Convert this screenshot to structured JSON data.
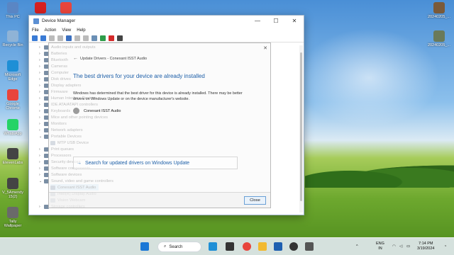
{
  "desktop": {
    "icons_left": [
      {
        "label": "This PC",
        "color": "#5a86c4"
      },
      {
        "label": "Recycle Bin",
        "color": "#8fb3d6"
      },
      {
        "label": "Microsoft Edge",
        "color": "#1e8fd6"
      },
      {
        "label": "Google Chrome",
        "color": "#e8453c"
      },
      {
        "label": "WhatsApp",
        "color": "#25d366"
      },
      {
        "label": "ElevenLabs",
        "color": "#444444"
      },
      {
        "label": "V_5Amendy 15(2)",
        "color": "#444444"
      },
      {
        "label": "Tally Wallpaper",
        "color": "#6a6a6a"
      }
    ],
    "icons_top": [
      {
        "label": "",
        "color": "#d62020"
      },
      {
        "label": "",
        "color": "#e8453c"
      }
    ],
    "icons_right": [
      {
        "label": "20240205_...",
        "color": "#7a5a3a"
      },
      {
        "label": "20240205_...",
        "color": "#6a7a5a"
      }
    ]
  },
  "window": {
    "title": "Device Manager",
    "menu": [
      "File",
      "Action",
      "View",
      "Help"
    ],
    "tree": [
      {
        "label": "Audio inputs and outputs",
        "expanded": false,
        "child": false
      },
      {
        "label": "Batteries",
        "child": false
      },
      {
        "label": "Bluetooth",
        "child": false
      },
      {
        "label": "Cameras",
        "child": false
      },
      {
        "label": "Computer",
        "child": false
      },
      {
        "label": "Disk drives",
        "child": false
      },
      {
        "label": "Display adapters",
        "child": false
      },
      {
        "label": "Firmware",
        "child": false
      },
      {
        "label": "Human Interface Devices",
        "child": false
      },
      {
        "label": "IDE ATA/ATAPI controllers",
        "child": false
      },
      {
        "label": "Keyboards",
        "child": false
      },
      {
        "label": "Mice and other pointing devices",
        "child": false
      },
      {
        "label": "Monitors",
        "child": false
      },
      {
        "label": "Network adapters",
        "child": false
      },
      {
        "label": "Portable Devices",
        "child": false,
        "expanded": true
      },
      {
        "label": "MTP USB Device",
        "child": true
      },
      {
        "label": "Print queues",
        "child": false
      },
      {
        "label": "Processors",
        "child": false
      },
      {
        "label": "Security devices",
        "child": false
      },
      {
        "label": "Software components",
        "child": false
      },
      {
        "label": "Software devices",
        "child": false
      },
      {
        "label": "Sound, video and game controllers",
        "child": false,
        "expanded": true
      },
      {
        "label": "Conexant ISST Audio",
        "child": true,
        "selected": true
      },
      {
        "label": "Intel(R) Display Audio",
        "child": true
      },
      {
        "label": "Vision Webcam",
        "child": true
      },
      {
        "label": "Storage controllers",
        "child": false
      }
    ]
  },
  "dialog": {
    "close_glyph": "✕",
    "back_glyph": "←",
    "breadcrumb": "Update Drivers - Conexant ISST Audio",
    "heading": "The best drivers for your device are already installed",
    "body": "Windows has determined that the best driver for this device is already installed. There may be better drivers on Windows Update or on the device manufacturer's website.",
    "device_name": "Conexant ISST Audio",
    "link_arrow": "→",
    "link_text": "Search for updated drivers on Windows Update",
    "close_button": "Close"
  },
  "taskbar": {
    "search_label": "Search",
    "language_top": "ENG",
    "language_bottom": "IN",
    "time": "7:14 PM",
    "date": "3/19/2024",
    "chevron": "^"
  },
  "colors": {
    "accent_blue": "#1d5fa8",
    "selection": "#cde6f7"
  }
}
